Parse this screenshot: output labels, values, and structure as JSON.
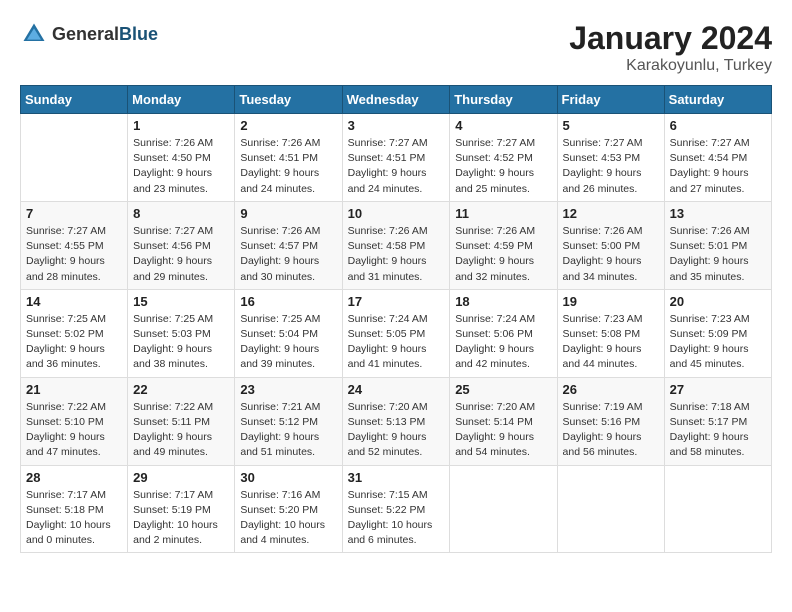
{
  "header": {
    "logo_general": "General",
    "logo_blue": "Blue",
    "month_year": "January 2024",
    "location": "Karakoyunlu, Turkey"
  },
  "weekdays": [
    "Sunday",
    "Monday",
    "Tuesday",
    "Wednesday",
    "Thursday",
    "Friday",
    "Saturday"
  ],
  "weeks": [
    [
      {
        "day": "",
        "sunrise": "",
        "sunset": "",
        "daylight": ""
      },
      {
        "day": "1",
        "sunrise": "Sunrise: 7:26 AM",
        "sunset": "Sunset: 4:50 PM",
        "daylight": "Daylight: 9 hours and 23 minutes."
      },
      {
        "day": "2",
        "sunrise": "Sunrise: 7:26 AM",
        "sunset": "Sunset: 4:51 PM",
        "daylight": "Daylight: 9 hours and 24 minutes."
      },
      {
        "day": "3",
        "sunrise": "Sunrise: 7:27 AM",
        "sunset": "Sunset: 4:51 PM",
        "daylight": "Daylight: 9 hours and 24 minutes."
      },
      {
        "day": "4",
        "sunrise": "Sunrise: 7:27 AM",
        "sunset": "Sunset: 4:52 PM",
        "daylight": "Daylight: 9 hours and 25 minutes."
      },
      {
        "day": "5",
        "sunrise": "Sunrise: 7:27 AM",
        "sunset": "Sunset: 4:53 PM",
        "daylight": "Daylight: 9 hours and 26 minutes."
      },
      {
        "day": "6",
        "sunrise": "Sunrise: 7:27 AM",
        "sunset": "Sunset: 4:54 PM",
        "daylight": "Daylight: 9 hours and 27 minutes."
      }
    ],
    [
      {
        "day": "7",
        "sunrise": "Sunrise: 7:27 AM",
        "sunset": "Sunset: 4:55 PM",
        "daylight": "Daylight: 9 hours and 28 minutes."
      },
      {
        "day": "8",
        "sunrise": "Sunrise: 7:27 AM",
        "sunset": "Sunset: 4:56 PM",
        "daylight": "Daylight: 9 hours and 29 minutes."
      },
      {
        "day": "9",
        "sunrise": "Sunrise: 7:26 AM",
        "sunset": "Sunset: 4:57 PM",
        "daylight": "Daylight: 9 hours and 30 minutes."
      },
      {
        "day": "10",
        "sunrise": "Sunrise: 7:26 AM",
        "sunset": "Sunset: 4:58 PM",
        "daylight": "Daylight: 9 hours and 31 minutes."
      },
      {
        "day": "11",
        "sunrise": "Sunrise: 7:26 AM",
        "sunset": "Sunset: 4:59 PM",
        "daylight": "Daylight: 9 hours and 32 minutes."
      },
      {
        "day": "12",
        "sunrise": "Sunrise: 7:26 AM",
        "sunset": "Sunset: 5:00 PM",
        "daylight": "Daylight: 9 hours and 34 minutes."
      },
      {
        "day": "13",
        "sunrise": "Sunrise: 7:26 AM",
        "sunset": "Sunset: 5:01 PM",
        "daylight": "Daylight: 9 hours and 35 minutes."
      }
    ],
    [
      {
        "day": "14",
        "sunrise": "Sunrise: 7:25 AM",
        "sunset": "Sunset: 5:02 PM",
        "daylight": "Daylight: 9 hours and 36 minutes."
      },
      {
        "day": "15",
        "sunrise": "Sunrise: 7:25 AM",
        "sunset": "Sunset: 5:03 PM",
        "daylight": "Daylight: 9 hours and 38 minutes."
      },
      {
        "day": "16",
        "sunrise": "Sunrise: 7:25 AM",
        "sunset": "Sunset: 5:04 PM",
        "daylight": "Daylight: 9 hours and 39 minutes."
      },
      {
        "day": "17",
        "sunrise": "Sunrise: 7:24 AM",
        "sunset": "Sunset: 5:05 PM",
        "daylight": "Daylight: 9 hours and 41 minutes."
      },
      {
        "day": "18",
        "sunrise": "Sunrise: 7:24 AM",
        "sunset": "Sunset: 5:06 PM",
        "daylight": "Daylight: 9 hours and 42 minutes."
      },
      {
        "day": "19",
        "sunrise": "Sunrise: 7:23 AM",
        "sunset": "Sunset: 5:08 PM",
        "daylight": "Daylight: 9 hours and 44 minutes."
      },
      {
        "day": "20",
        "sunrise": "Sunrise: 7:23 AM",
        "sunset": "Sunset: 5:09 PM",
        "daylight": "Daylight: 9 hours and 45 minutes."
      }
    ],
    [
      {
        "day": "21",
        "sunrise": "Sunrise: 7:22 AM",
        "sunset": "Sunset: 5:10 PM",
        "daylight": "Daylight: 9 hours and 47 minutes."
      },
      {
        "day": "22",
        "sunrise": "Sunrise: 7:22 AM",
        "sunset": "Sunset: 5:11 PM",
        "daylight": "Daylight: 9 hours and 49 minutes."
      },
      {
        "day": "23",
        "sunrise": "Sunrise: 7:21 AM",
        "sunset": "Sunset: 5:12 PM",
        "daylight": "Daylight: 9 hours and 51 minutes."
      },
      {
        "day": "24",
        "sunrise": "Sunrise: 7:20 AM",
        "sunset": "Sunset: 5:13 PM",
        "daylight": "Daylight: 9 hours and 52 minutes."
      },
      {
        "day": "25",
        "sunrise": "Sunrise: 7:20 AM",
        "sunset": "Sunset: 5:14 PM",
        "daylight": "Daylight: 9 hours and 54 minutes."
      },
      {
        "day": "26",
        "sunrise": "Sunrise: 7:19 AM",
        "sunset": "Sunset: 5:16 PM",
        "daylight": "Daylight: 9 hours and 56 minutes."
      },
      {
        "day": "27",
        "sunrise": "Sunrise: 7:18 AM",
        "sunset": "Sunset: 5:17 PM",
        "daylight": "Daylight: 9 hours and 58 minutes."
      }
    ],
    [
      {
        "day": "28",
        "sunrise": "Sunrise: 7:17 AM",
        "sunset": "Sunset: 5:18 PM",
        "daylight": "Daylight: 10 hours and 0 minutes."
      },
      {
        "day": "29",
        "sunrise": "Sunrise: 7:17 AM",
        "sunset": "Sunset: 5:19 PM",
        "daylight": "Daylight: 10 hours and 2 minutes."
      },
      {
        "day": "30",
        "sunrise": "Sunrise: 7:16 AM",
        "sunset": "Sunset: 5:20 PM",
        "daylight": "Daylight: 10 hours and 4 minutes."
      },
      {
        "day": "31",
        "sunrise": "Sunrise: 7:15 AM",
        "sunset": "Sunset: 5:22 PM",
        "daylight": "Daylight: 10 hours and 6 minutes."
      },
      {
        "day": "",
        "sunrise": "",
        "sunset": "",
        "daylight": ""
      },
      {
        "day": "",
        "sunrise": "",
        "sunset": "",
        "daylight": ""
      },
      {
        "day": "",
        "sunrise": "",
        "sunset": "",
        "daylight": ""
      }
    ]
  ]
}
